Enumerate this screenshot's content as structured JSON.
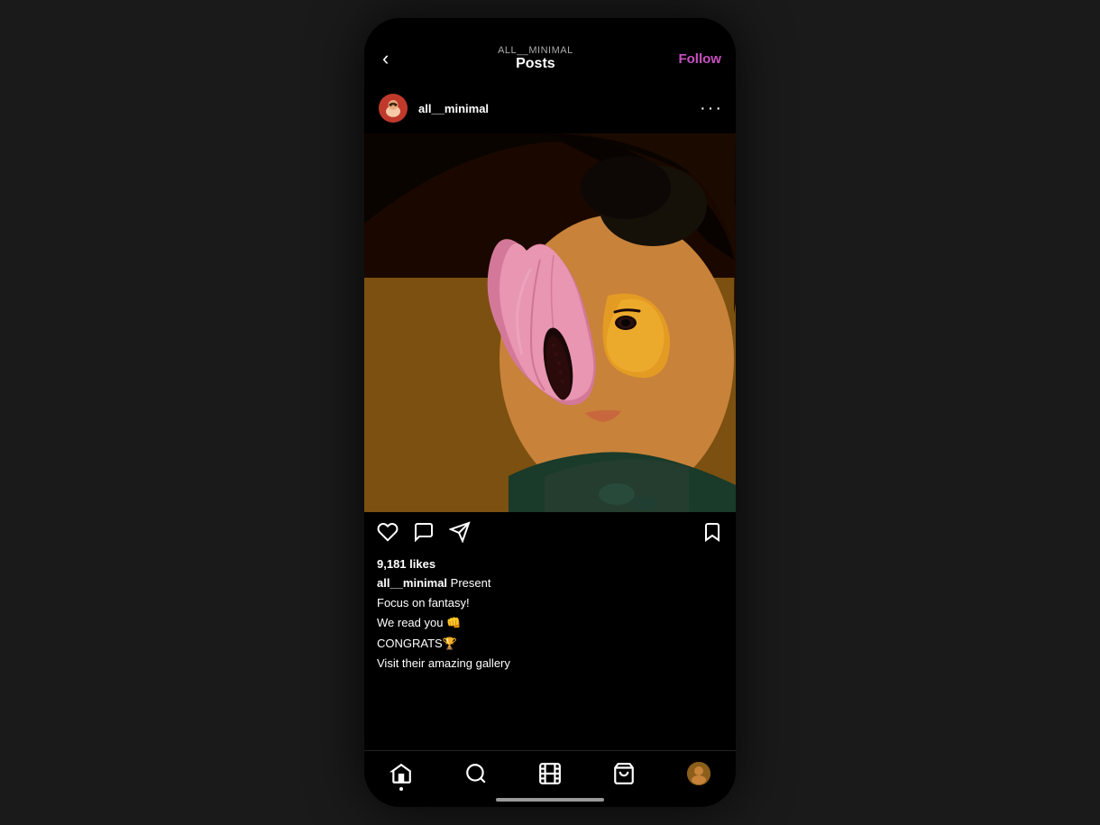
{
  "app": {
    "bg_color": "#1a1a1a"
  },
  "top_nav": {
    "back_label": "‹",
    "username_label": "ALL__MINIMAL",
    "title": "Posts",
    "follow_label": "Follow"
  },
  "post_header": {
    "username": "all__minimal",
    "more_dots": "···"
  },
  "post": {
    "likes": "9,181 likes",
    "caption_user": "all__minimal",
    "caption_text": " Present",
    "line1": "Focus on fantasy!",
    "line2": "We read you 👊",
    "line3": "CONGRATS🏆",
    "line4": "Visit their amazing gallery"
  },
  "bottom_nav": {
    "home_icon": "⌂",
    "search_icon": "🔍",
    "reels_icon": "▶",
    "shop_icon": "🛍",
    "profile_icon": "👤"
  }
}
